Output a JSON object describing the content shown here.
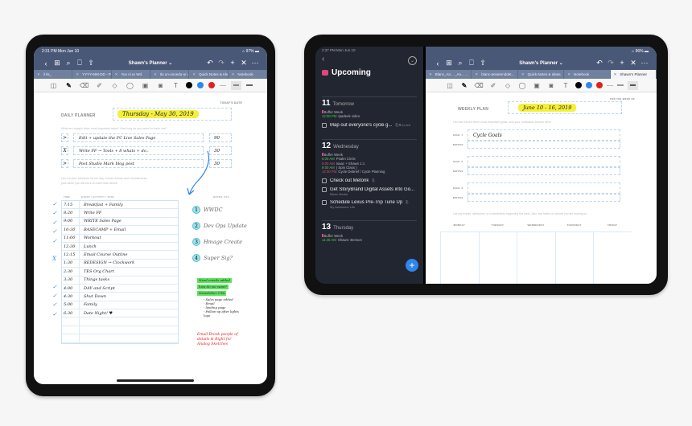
{
  "left_ipad": {
    "status": {
      "time": "2:31 PM  Mon Jun 10",
      "battery": "97%"
    },
    "nav": {
      "title": "Shawn's Planner ⌄",
      "back": "‹",
      "grid": "⊞",
      "search": "⌕",
      "bookmark": "⎕",
      "share": "⇧",
      "undo": "↶",
      "redo": "↷",
      "add": "+",
      "close": "✕",
      "more": "⋯"
    },
    "tabs": [
      "il Ils_",
      "YYYY-MM-DD - Pl...",
      "Yoo ni ur Wd",
      "Ilo un-unoedu-ur a",
      "Quick Notes & Ideas",
      "Notebook"
    ],
    "page": {
      "todays_date_label": "TODAY'S DATE",
      "title": "DAILY PLANNER",
      "date_value": "Thursday - May 30, 2019",
      "tasks_prompt": "What are today's three most important tasks? How long do you need for each one?",
      "tasks": [
        {
          "mark": ">",
          "text": "Edit + update the FC Live Sales Page",
          "minutes": "90"
        },
        {
          "mark": "X",
          "text": "Write FF → Tools + 8 whats + do..",
          "minutes": "30"
        },
        {
          "mark": ">",
          "text": "Post Studio Mark blog post",
          "minutes": "30"
        }
      ],
      "schedule_prompt_1": "List out your schedule for the day: known events and commitments,",
      "schedule_prompt_2": "plus when you will work on each task above.",
      "time_header": "TIME",
      "event_header": "EVENT / ACTIVITY / TASK",
      "notes_header": "NOTES, ETC.",
      "schedule": [
        {
          "check": "✓",
          "time": "7:15",
          "event": "Breakfast + Family"
        },
        {
          "check": "✓",
          "time": "8:20",
          "event": "Write FF"
        },
        {
          "check": "✓",
          "time": "9:00",
          "event": "WRITE Sales Page"
        },
        {
          "check": "✓",
          "time": "10:30",
          "event": "BASECAMP + Email"
        },
        {
          "check": "✓",
          "time": "11:00",
          "event": "Workout"
        },
        {
          "check": "",
          "time": "12:30",
          "event": "Lunch"
        },
        {
          "check": "X",
          "time": "12:15",
          "event": "Email Course Outline"
        },
        {
          "check": "",
          "time": "1:30",
          "event": "REDESIGN → Clockwork"
        },
        {
          "check": "",
          "time": "2:30",
          "event": "TES Org Chart"
        },
        {
          "check": "✓",
          "time": "3:30",
          "event": "Things tasks"
        },
        {
          "check": "✓",
          "time": "4:00",
          "event": "DAY and Script"
        },
        {
          "check": "✓",
          "time": "4:30",
          "event": "Shut Down"
        },
        {
          "check": "✓",
          "time": "5:00",
          "event": "Family"
        },
        {
          "check": "",
          "time": "6:30",
          "event": "Date Night! ♥"
        },
        {
          "check": "",
          "time": "",
          "event": ""
        },
        {
          "check": "",
          "time": "",
          "event": ""
        },
        {
          "check": "",
          "time": "",
          "event": ""
        }
      ],
      "notes": [
        {
          "num": "1",
          "text": "WWDC"
        },
        {
          "num": "2",
          "text": "Dev Ops Update"
        },
        {
          "num": "3",
          "text": "Hmage Create"
        },
        {
          "num": "4",
          "text": "Super Sig?"
        }
      ],
      "green_notes": [
        "Need emails added",
        "how do we want?",
        "Newsletter CTA"
      ],
      "sub_notes": [
        "- Sales page edited",
        "- Email",
        "- landing page",
        "- Follow-up after lights",
        "  logo"
      ],
      "red_note": "Email Brook people of details & Right for Analog Sketches"
    }
  },
  "right_ipad": {
    "status": {
      "time": "2:37 PM  Mon Jun 10",
      "battery": "96%"
    },
    "things": {
      "title": "Upcoming",
      "back": "‹",
      "more": "⋯",
      "days": [
        {
          "num": "11",
          "name": "Tomorrow",
          "events": [
            {
              "time": "",
              "label": "Buffer Week",
              "color": "#e0467c"
            },
            {
              "time": "12:00 PM",
              "label": "Ipadeek video",
              "color": "#4cc94c"
            }
          ],
          "tasks": [
            {
              "title": "Map out everyone's cycle g...",
              "sub": "",
              "meta": "⎘ ⚑ 1d left"
            }
          ]
        },
        {
          "num": "12",
          "name": "Wednesday",
          "events": [
            {
              "time": "",
              "label": "Buffer Week",
              "color": "#e0467c"
            },
            {
              "time": "6:00 AM",
              "label": "Psalm Circle",
              "color": "#4cc94c"
            },
            {
              "time": "8:00 AM",
              "label": "Isaac + Shawn 1:1",
              "color": "#e0467c"
            },
            {
              "time": "9:00 AM",
              "label": "( Spin Class )",
              "color": "#4cc94c"
            },
            {
              "time": "12:00 PM",
              "label": "Cycle Debrief / Cycle Planning",
              "color": "#e0467c"
            }
          ],
          "tasks": [
            {
              "title": "Check out Metorik",
              "sub": "",
              "meta": "⎘"
            },
            {
              "title": "Get StoryBrand Digital Assets into Go...",
              "sub": "Blanc Media",
              "meta": ""
            },
            {
              "title": "Schedule Lexus Pre-Trip Tune Up",
              "sub": "My Awesome Life",
              "meta": "⎘"
            }
          ]
        },
        {
          "num": "13",
          "name": "Thursday",
          "events": [
            {
              "time": "",
              "label": "Buffer Week",
              "color": "#e0467c"
            },
            {
              "time": "11:45 AM",
              "label": "Shawn: Benson",
              "color": "#4cc94c"
            }
          ],
          "tasks": []
        }
      ],
      "add": "+"
    },
    "nav": {
      "title": "Shawn's Planner ⌄",
      "back": "‹",
      "grid": "⊞",
      "search": "⌕",
      "bookmark": "⎕",
      "share": "⇧",
      "undo": "↶",
      "redo": "↷",
      "add": "+",
      "close": "✕",
      "more": "⋯"
    },
    "tabs": [
      "Blanc_An... _An... ...",
      "blanc-annamnddet...",
      "Quick Notes & Ideas",
      "Notebook",
      "Shawn's Planner"
    ],
    "page": {
      "week_label": "FOR THE WEEK OF",
      "title": "WEEKLY PLAN",
      "week_value": "June 10 - 16, 2019",
      "goals_prompt": "List this week's three most important goals, and your motivation behind them.",
      "goals": [
        {
          "goal_label": "GOAL 1",
          "goal": "Cycle Goals",
          "motive_label": "MOTIVE",
          "motive": ""
        },
        {
          "goal_label": "GOAL 2",
          "goal": "",
          "motive_label": "MOTIVE",
          "motive": ""
        },
        {
          "goal_label": "GOAL 3",
          "goal": "",
          "motive_label": "MOTIVE",
          "motive": ""
        }
      ],
      "events_prompt": "List any events, milestones, or commitments happening this week. Also, any habits or routines you are working on.",
      "days": [
        "MONDAY",
        "TUESDAY",
        "WEDNESDAY",
        "THURSDAY",
        "FRIDAY"
      ]
    }
  },
  "colors": {
    "nav": "#4a5878",
    "tabs": "#7081a0",
    "highlight_yellow": "#f5f03a",
    "highlight_green": "#5be35b",
    "accent_blue": "#2f86eb",
    "ink_red": "#e0201c",
    "things_bg": "#222631",
    "things_pink": "#e0467c",
    "things_green": "#4cc94c"
  }
}
